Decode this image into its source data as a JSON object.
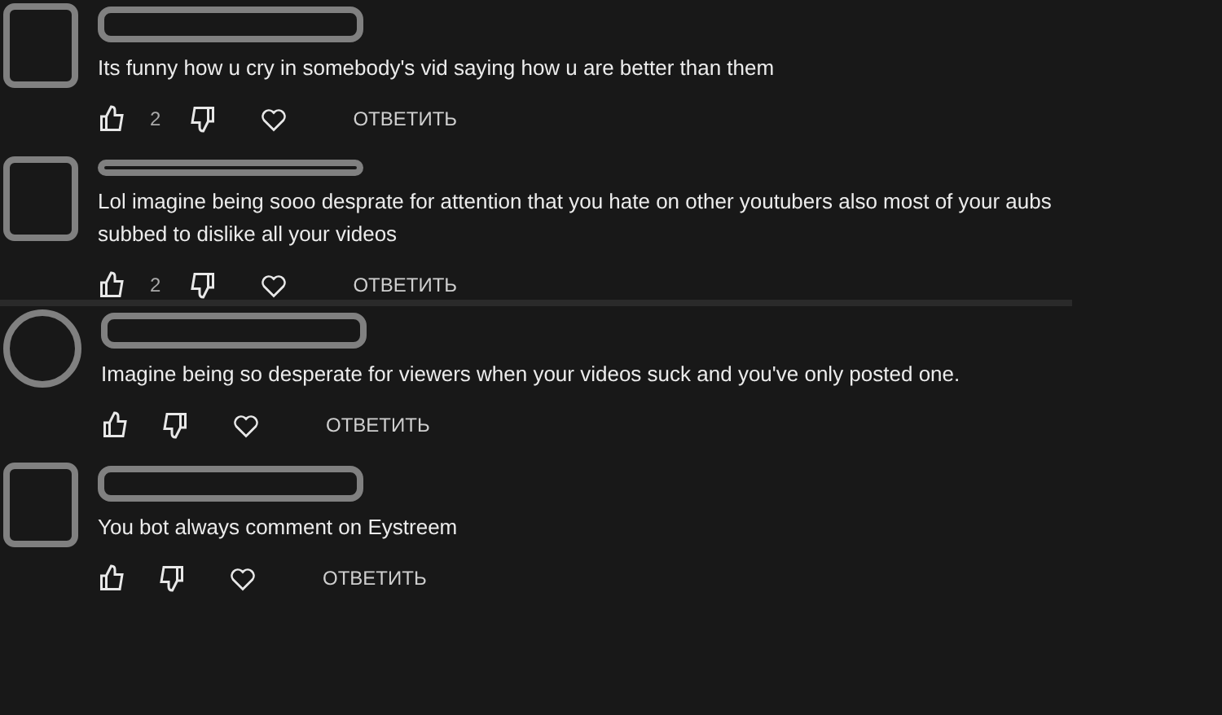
{
  "comments": [
    {
      "kind": "square",
      "text": "Its funny how u cry in somebody's vid saying how u are better than them",
      "likes": "2",
      "reply": "ОТВЕТИТЬ",
      "divider_after": false
    },
    {
      "kind": "square",
      "text": "Lol imagine being sooo desprate for attention that you hate on other youtubers also most of your aubs subbed to dislike all your videos",
      "likes": "2",
      "reply": "ОТВЕТИТЬ",
      "divider_after": true
    },
    {
      "kind": "circle",
      "text": "Imagine being so desperate for viewers when your videos suck and you've only posted one.",
      "reply": "ОТВЕТИТЬ",
      "divider_after": false
    },
    {
      "kind": "square",
      "text": "You bot always comment on Eystreem",
      "reply": "ОТВЕТИТЬ",
      "divider_after": false
    }
  ]
}
